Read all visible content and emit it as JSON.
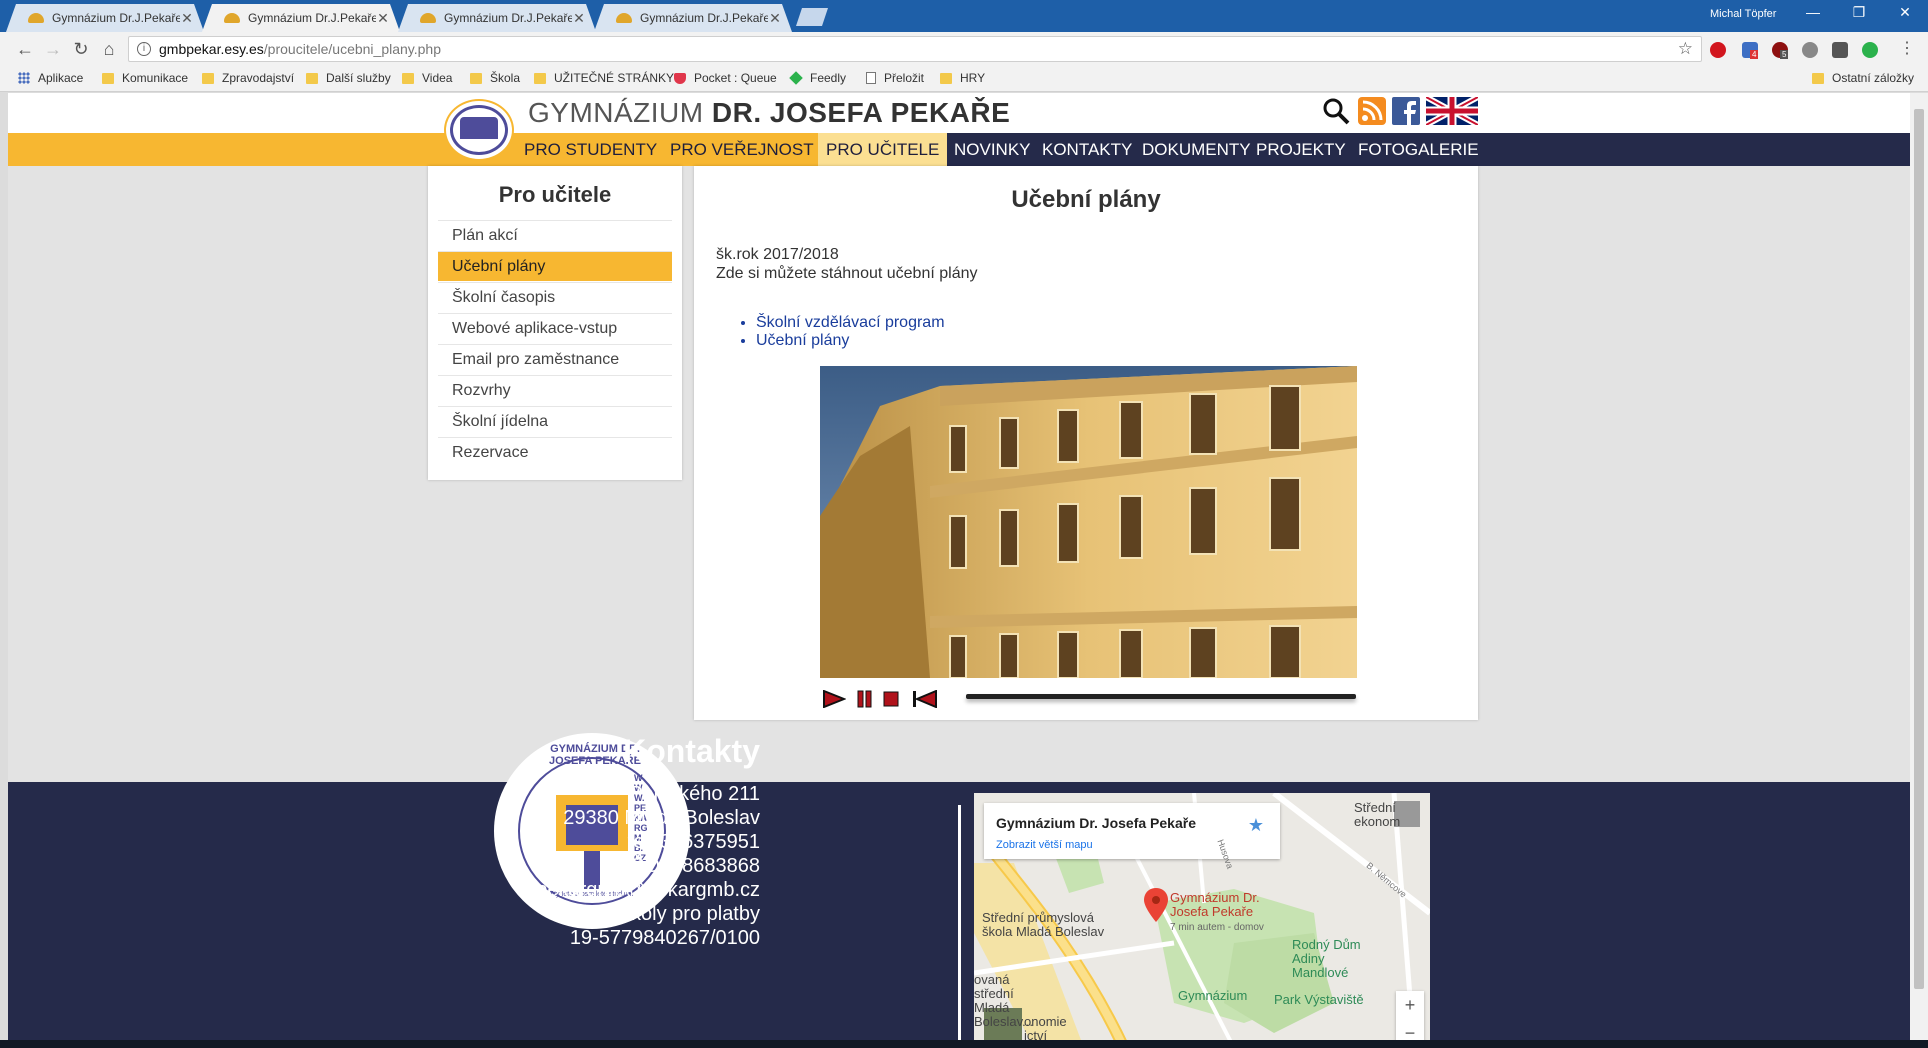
{
  "browser": {
    "tabs": [
      {
        "title": "Gymnázium Dr.J.Pekaře"
      },
      {
        "title": "Gymnázium Dr.J.Pekaře"
      },
      {
        "title": "Gymnázium Dr.J.Pekaře"
      },
      {
        "title": "Gymnázium Dr.J.Pekaře"
      }
    ],
    "user": "Michal Töpfer",
    "url_host": "gmbpekar.esy.es",
    "url_path": "/proucitele/ucebni_plany.php",
    "bookmarks": [
      "Aplikace",
      "Komunikace",
      "Zpravodajství",
      "Další služby",
      "Videa",
      "Škola",
      "UŽITEČNÉ STRÁNKY",
      "Pocket : Queue",
      "Feedly",
      "Přeložit",
      "HRY"
    ],
    "other_bookmarks": "Ostatní záložky",
    "ext_badges": [
      "4",
      "5"
    ]
  },
  "site": {
    "title_light": "GYMNÁZIUM",
    "title_bold": "DR. JOSEFA PEKAŘE",
    "nav": [
      "PRO STUDENTY",
      "PRO VEŘEJNOST",
      "PRO UČITELE",
      "NOVINKY",
      "KONTAKTY",
      "DOKUMENTY",
      "PROJEKTY",
      "FOTOGALERIE"
    ],
    "nav_selected": "PRO UČITELE"
  },
  "sidebar": {
    "title": "Pro učitele",
    "items": [
      "Plán akcí",
      "Učební plány",
      "Školní časopis",
      "Webové aplikace-vstup",
      "Email pro zaměstnance",
      "Rozvrhy",
      "Školní jídelna",
      "Rezervace"
    ],
    "active": "Učební plány"
  },
  "main": {
    "title": "Učební plány",
    "year": "šk.rok 2017/2018",
    "intro": "Zde si můžete stáhnout učební plány",
    "links": [
      "Školní vzdělávací program",
      "Učební plány"
    ]
  },
  "footer": {
    "heading": "Kontakty",
    "lines": [
      "Palackého 211",
      "29380 Mladá Boleslav",
      "tel: 326375951",
      "IČO: 48683868",
      "pekargmb@pekargmb.cz",
      "č. účtu školy pro platby",
      "19-5779840267/0100"
    ],
    "seal_top": "GYMNÁZIUM DR. JOSEFA PEKAŘE",
    "seal_side": "WWW.PEKARGMB.CZ",
    "seal_small": "čtyřleté a osmileté studium"
  },
  "map": {
    "card_title": "Gymnázium Dr. Josefa Pekaře",
    "card_link": "Zobrazit větší mapu",
    "labels": {
      "stredni_ekonom": "Střední ekonom",
      "pin": "Gymnázium Dr. Josefa Pekaře",
      "pin_sub": "7 min autem - domov",
      "prumyslova": "Střední průmyslová škola Mladá Boleslav",
      "rodny_dum": "Rodný Dům Adiny Mandlové",
      "gymnazium": "Gymnázium",
      "park": "Park Výstaviště",
      "stredni2": "ovaná střední Mladá Boleslav...",
      "ekonomie": "onomie ictví",
      "street1": "Husova",
      "street2": "B. Němcove"
    },
    "zoom_in": "+",
    "zoom_out": "−"
  },
  "colors": {
    "accent": "#f7b731",
    "dark": "#252a4a",
    "link": "#1a3d9c"
  }
}
